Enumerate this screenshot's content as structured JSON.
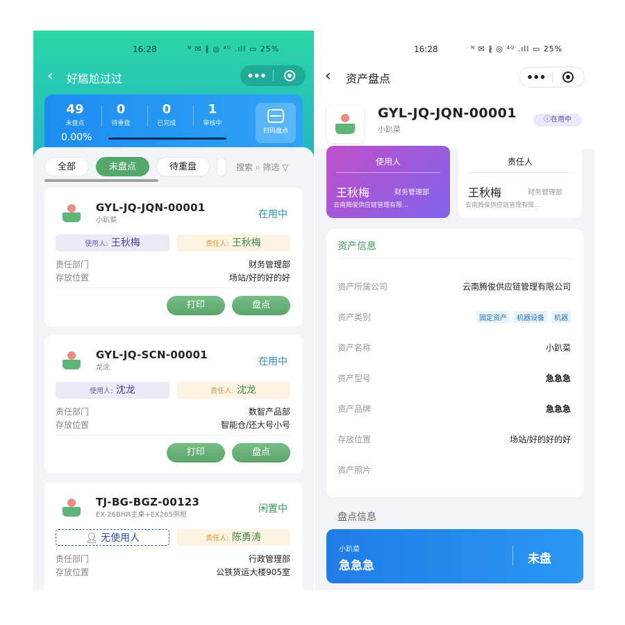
{
  "left": {
    "status_bar": {
      "time": "16:28",
      "icons": "ᴺ ✉ ∦ ◎ ⁴ᴳ .ıll ▭ 25%"
    },
    "nav": {
      "back": "‹",
      "title": "好尴尬过过",
      "more": "•••"
    },
    "stats": [
      {
        "num": "49",
        "label": "未盘点"
      },
      {
        "num": "0",
        "label": "待重盘"
      },
      {
        "num": "0",
        "label": "已完成"
      },
      {
        "num": "1",
        "label": "审核中"
      }
    ],
    "progress": {
      "text": "0.00%",
      "value": 0
    },
    "scan_label": "扫码盘点",
    "tabs": [
      "全部",
      "未盘点",
      "待重盘"
    ],
    "search_text": "搜索 ⌕  筛选 ▽",
    "cards": [
      {
        "code": "GYL-JQ-JQN-00001",
        "sub": "小趴菜",
        "status": "在用中",
        "user_prefix": "使用人:",
        "user": "王秋梅",
        "owner_prefix": "责任人:",
        "owner": "王秋梅",
        "dept_label": "责任部门",
        "dept": "财务管理部",
        "loc_label": "存放位置",
        "loc": "场站/好的好的好",
        "print": "打印",
        "check": "盘点"
      },
      {
        "code": "GYL-JQ-SCN-00001",
        "sub": "龙沈",
        "status": "在用中",
        "user_prefix": "使用人:",
        "user": "沈龙",
        "owner_prefix": "责任人:",
        "owner": "沈龙",
        "dept_label": "责任部门",
        "dept": "数智产品部",
        "loc_label": "存放位置",
        "loc": "智能仓/还大号小号",
        "print": "打印",
        "check": "盘点"
      },
      {
        "code": "TJ-BG-BGZ-00123",
        "sub": "EX-26BHR主桌+EX265侧柜",
        "status": "闲置中",
        "user": "无使用人",
        "owner_prefix": "责任人:",
        "owner": "陈勇涛",
        "dept_label": "责任部门",
        "dept": "行政管理部",
        "loc_label": "存放位置",
        "loc": "公铁货运大楼905室"
      }
    ]
  },
  "right": {
    "status_bar": {
      "time": "16:28",
      "icons": "ᴺ ✉ ∦ ◎ ⁴ᴳ .ıll ▭ 25%"
    },
    "nav": {
      "back": "‹",
      "title": "资产盘点",
      "more": "•••"
    },
    "asset": {
      "code": "GYL-JQ-JQN-00001",
      "sub": "小趴菜",
      "badge": "ⓘ在用中"
    },
    "user_card": {
      "title": "使用人",
      "name": "王秋梅",
      "dept": "财务管理部",
      "company": "云南腾俊供应链管理有限…"
    },
    "owner_card": {
      "title": "责任人",
      "name": "王秋梅",
      "dept": "财务管理部",
      "company": "云南腾俊供应链管理有限…"
    },
    "info": {
      "title": "资产信息",
      "rows": [
        {
          "label": "资产所属公司",
          "value": "云南腾俊供应链管理有限公司"
        },
        {
          "label": "资产类别",
          "tags": [
            "固定资产",
            "机器设备",
            "机器"
          ]
        },
        {
          "label": "资产名称",
          "value": "小趴菜"
        },
        {
          "label": "资产型号",
          "value": "急急急"
        },
        {
          "label": "资产品牌",
          "value": "急急急"
        },
        {
          "label": "存放位置",
          "value": "场站/好的好的好"
        },
        {
          "label": "资产照片",
          "value": ""
        }
      ]
    },
    "check_section_title": "盘点信息",
    "check": {
      "sub": "小趴菜",
      "name": "急急急",
      "state": "未盘"
    }
  }
}
